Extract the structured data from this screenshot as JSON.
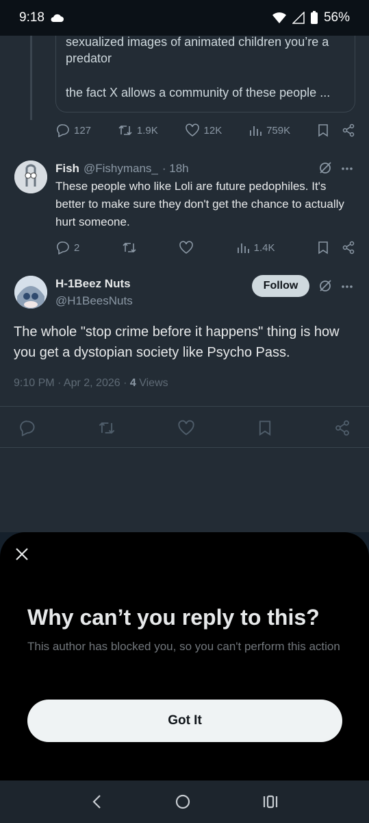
{
  "status_bar": {
    "time": "9:18",
    "battery": "56%"
  },
  "quoted_tweet": {
    "line1": "sexualized images of animated children you’re a predator",
    "line2": "the fact X allows a community of these people ..."
  },
  "parent_actions": {
    "replies": "127",
    "reposts": "1.9K",
    "likes": "12K",
    "views": "759K"
  },
  "reply_tweet": {
    "name": "Fish",
    "handle": "@Fishymans_",
    "time": "· 18h",
    "text": "These people who like Loli are future pedophiles. It's better to make sure they don't get the chance to actually hurt someone.",
    "replies": "2",
    "views": "1.4K"
  },
  "main_tweet": {
    "name": "H-1Beez Nuts",
    "handle": "@H1BeesNuts",
    "follow_label": "Follow",
    "text": "The whole \"stop crime before it happens\" thing is how you get a dystopian society like Psycho Pass.",
    "timestamp": "9:10 PM · Apr 2, 2026 · ",
    "views_count": "4",
    "views_label": " Views"
  },
  "sheet": {
    "title": "Why can’t you reply to this?",
    "body": "This author has blocked you, so you can't perform this action",
    "button": "Got It"
  },
  "icons": [
    "cloud-icon",
    "wifi-icon",
    "signal-icon",
    "battery-icon",
    "reply-icon",
    "repost-icon",
    "like-icon",
    "views-icon",
    "bookmark-icon",
    "share-icon",
    "grok-icon",
    "more-icon",
    "close-icon",
    "back-icon",
    "home-icon",
    "recents-icon"
  ],
  "colors": {
    "background": "#15202b",
    "sheet": "#000000",
    "muted": "#8b98a5",
    "button": "#eff3f4"
  }
}
